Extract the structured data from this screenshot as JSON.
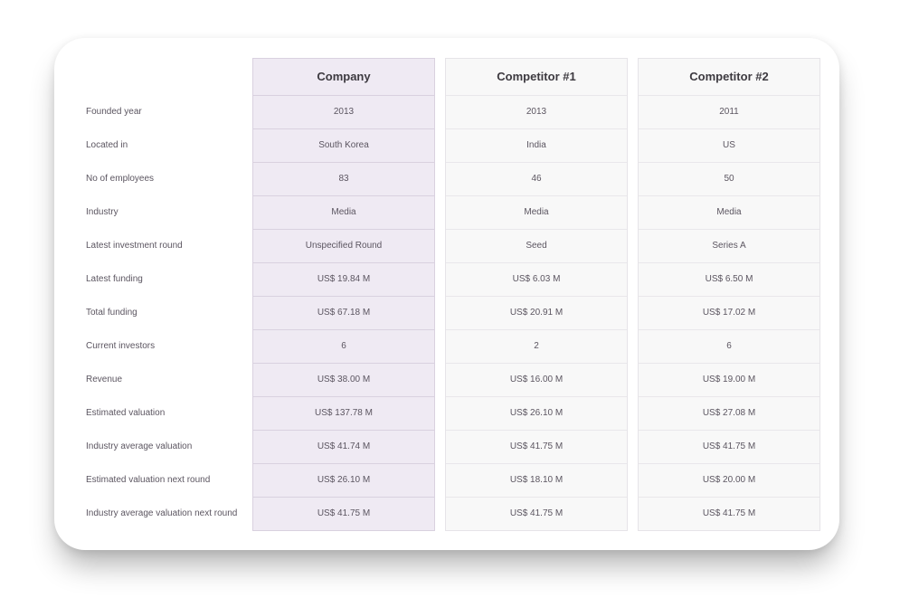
{
  "row_labels": [
    "Founded year",
    "Located in",
    "No of employees",
    "Industry",
    "Latest investment round",
    "Latest funding",
    "Total funding",
    "Current investors",
    "Revenue",
    "Estimated valuation",
    "Industry average valuation",
    "Estimated valuation next round",
    "Industry average valuation next round"
  ],
  "columns": [
    {
      "header": "Company",
      "values": [
        "2013",
        "South Korea",
        "83",
        "Media",
        "Unspecified Round",
        "US$ 19.84 M",
        "US$ 67.18 M",
        "6",
        "US$ 38.00 M",
        "US$ 137.78 M",
        "US$ 41.74 M",
        "US$ 26.10 M",
        "US$ 41.75 M"
      ]
    },
    {
      "header": "Competitor #1",
      "values": [
        "2013",
        "India",
        "46",
        "Media",
        "Seed",
        "US$ 6.03 M",
        "US$ 20.91 M",
        "2",
        "US$ 16.00 M",
        "US$ 26.10 M",
        "US$ 41.75 M",
        "US$ 18.10 M",
        "US$ 41.75 M"
      ]
    },
    {
      "header": "Competitor #2",
      "values": [
        "2011",
        "US",
        "50",
        "Media",
        "Series A",
        "US$ 6.50 M",
        "US$ 17.02 M",
        "6",
        "US$ 19.00 M",
        "US$ 27.08 M",
        "US$ 41.75 M",
        "US$ 20.00 M",
        "US$ 41.75 M"
      ]
    }
  ],
  "colors": {
    "company_column_bg": "#efeaf3",
    "competitor_column_bg": "#f8f8f8",
    "text": "#5b5560",
    "header_text": "#3d3a40"
  }
}
